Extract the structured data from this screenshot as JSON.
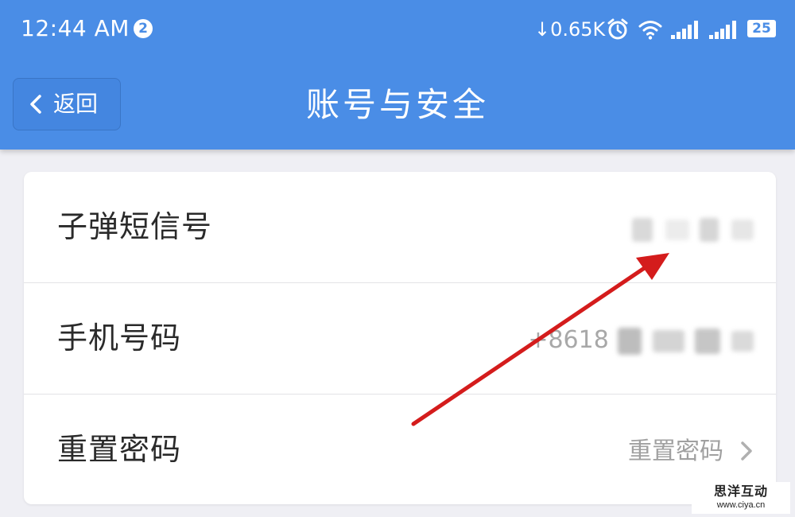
{
  "status_bar": {
    "time": "12:44 AM",
    "notification_count": "2",
    "net_speed": "0.65K",
    "battery": "25"
  },
  "nav": {
    "back_label": "返回",
    "title": "账号与安全"
  },
  "settings": {
    "rows": [
      {
        "label": "子弹短信号",
        "value": ""
      },
      {
        "label": "手机号码",
        "value": "+8618"
      },
      {
        "label": "重置密码",
        "value": "重置密码"
      }
    ]
  },
  "watermark": {
    "text": "思洋互动",
    "url": "www.ciya.cn"
  },
  "colors": {
    "header_blue": "#4a8de6",
    "annotation_red": "#d41c1c",
    "background": "#efeff4"
  }
}
